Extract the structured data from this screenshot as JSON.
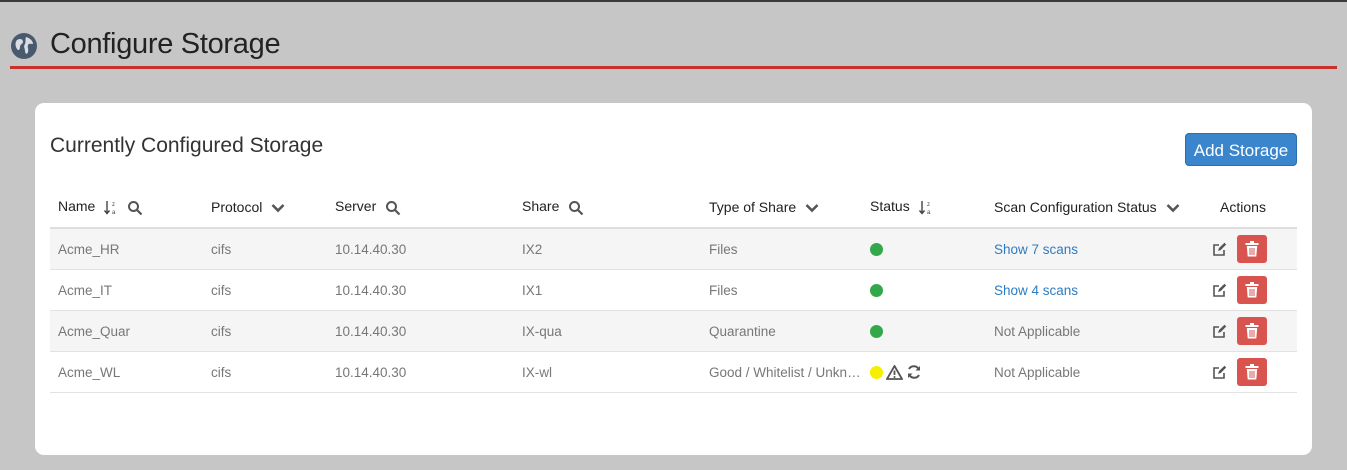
{
  "page": {
    "title": "Configure Storage"
  },
  "card": {
    "title": "Currently Configured Storage",
    "add_button": "Add Storage"
  },
  "columns": {
    "name": "Name",
    "protocol": "Protocol",
    "server": "Server",
    "share": "Share",
    "type": "Type of Share",
    "status": "Status",
    "scan": "Scan Configuration Status",
    "actions": "Actions"
  },
  "rows": [
    {
      "name": "Acme_HR",
      "protocol": "cifs",
      "server": "10.14.40.30",
      "share": "IX2",
      "type": "Files",
      "status": "green",
      "scan": "Show 7 scans",
      "scan_is_link": true
    },
    {
      "name": "Acme_IT",
      "protocol": "cifs",
      "server": "10.14.40.30",
      "share": "IX1",
      "type": "Files",
      "status": "green",
      "scan": "Show 4 scans",
      "scan_is_link": true
    },
    {
      "name": "Acme_Quar",
      "protocol": "cifs",
      "server": "10.14.40.30",
      "share": "IX-qua",
      "type": "Quarantine",
      "status": "green",
      "scan": "Not Applicable",
      "scan_is_link": false
    },
    {
      "name": "Acme_WL",
      "protocol": "cifs",
      "server": "10.14.40.30",
      "share": "IX-wl",
      "type": "Good / Whitelist / Unknown",
      "status": "yellow",
      "scan": "Not Applicable",
      "scan_is_link": false
    }
  ],
  "colors": {
    "accent_red": "#c8302c",
    "button_blue": "#3a85cc",
    "status_green": "#33a84a",
    "status_yellow": "#f6ef00",
    "delete_red": "#d9534f",
    "link_blue": "#2e7cc0"
  }
}
